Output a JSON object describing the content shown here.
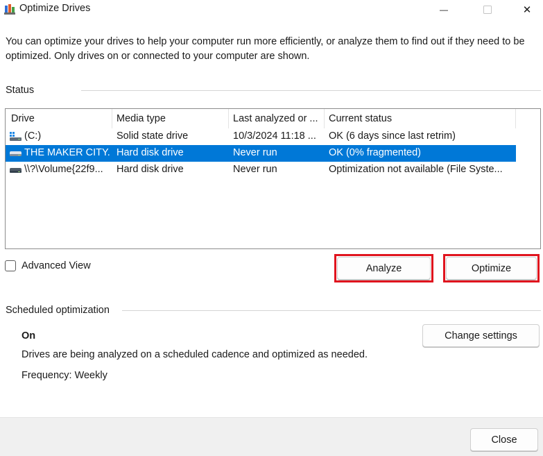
{
  "window": {
    "title": "Optimize Drives",
    "minimize_glyph": "—",
    "close_glyph": "✕"
  },
  "description": "You can optimize your drives to help your computer run more efficiently, or analyze them to find out if they need to be optimized. Only drives on or connected to your computer are shown.",
  "status": {
    "label": "Status",
    "columns": [
      "Drive",
      "Media type",
      "Last analyzed or ...",
      "Current status"
    ],
    "drives": [
      {
        "drive": "(C:)",
        "media": "Solid state drive",
        "last": "10/3/2024 11:18 ...",
        "status": "OK (6 days since last retrim)",
        "icon": "windows-drive-icon",
        "selected": false
      },
      {
        "drive": "THE MAKER CITY...",
        "media": "Hard disk drive",
        "last": "Never run",
        "status": "OK (0% fragmented)",
        "icon": "hard-drive-icon",
        "selected": true
      },
      {
        "drive": "\\\\?\\Volume{22f9...",
        "media": "Hard disk drive",
        "last": "Never run",
        "status": "Optimization not available (File Syste...",
        "icon": "hard-drive-icon",
        "selected": false
      }
    ]
  },
  "advanced_view_label": "Advanced View",
  "buttons": {
    "analyze": "Analyze",
    "optimize": "Optimize",
    "change_settings": "Change settings",
    "close": "Close"
  },
  "scheduled": {
    "label": "Scheduled optimization",
    "state": "On",
    "description": "Drives are being analyzed on a scheduled cadence and optimized as needed.",
    "frequency": "Frequency: Weekly"
  },
  "colors": {
    "selection": "#0078d7",
    "highlight_border": "#e0141e"
  }
}
